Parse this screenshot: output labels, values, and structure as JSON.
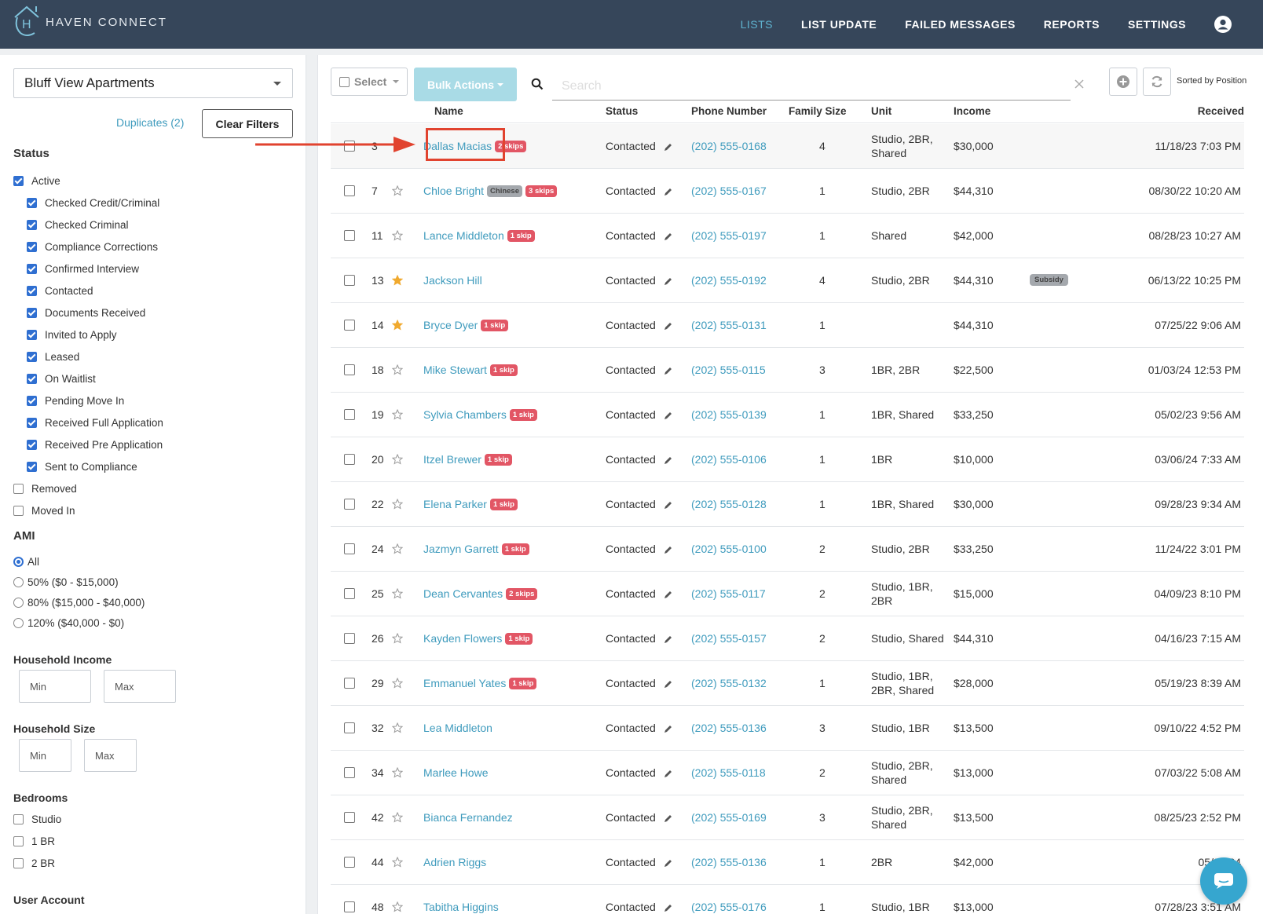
{
  "brand": {
    "name": "HAVEN CONNECT",
    "logo_letter": "H"
  },
  "nav": {
    "items": [
      {
        "label": "LISTS",
        "active": true
      },
      {
        "label": "LIST UPDATE",
        "active": false
      },
      {
        "label": "FAILED MESSAGES",
        "active": false
      },
      {
        "label": "REPORTS",
        "active": false
      },
      {
        "label": "SETTINGS",
        "active": false
      }
    ],
    "user_icon": "user-circle-icon"
  },
  "sidebar": {
    "property": "Bluff View Apartments",
    "duplicates_label": "Duplicates (2)",
    "clear_filters_label": "Clear Filters",
    "status": {
      "title": "Status",
      "active": {
        "label": "Active",
        "checked": true
      },
      "active_children": [
        {
          "label": "Checked Credit/Criminal",
          "checked": true
        },
        {
          "label": "Checked Criminal",
          "checked": true
        },
        {
          "label": "Compliance Corrections",
          "checked": true
        },
        {
          "label": "Confirmed Interview",
          "checked": true
        },
        {
          "label": "Contacted",
          "checked": true
        },
        {
          "label": "Documents Received",
          "checked": true
        },
        {
          "label": "Invited to Apply",
          "checked": true
        },
        {
          "label": "Leased",
          "checked": true
        },
        {
          "label": "On Waitlist",
          "checked": true
        },
        {
          "label": "Pending Move In",
          "checked": true
        },
        {
          "label": "Received Full Application",
          "checked": true
        },
        {
          "label": "Received Pre Application",
          "checked": true
        },
        {
          "label": "Sent to Compliance",
          "checked": true
        }
      ],
      "others": [
        {
          "label": "Removed",
          "checked": false
        },
        {
          "label": "Moved In",
          "checked": false
        }
      ]
    },
    "ami": {
      "title": "AMI",
      "options": [
        {
          "label": "All",
          "selected": true
        },
        {
          "label": "50% ($0 - $15,000)",
          "selected": false
        },
        {
          "label": "80% ($15,000 - $40,000)",
          "selected": false
        },
        {
          "label": "120% ($40,000 - $0)",
          "selected": false
        }
      ]
    },
    "household_income": {
      "title": "Household Income",
      "min_placeholder": "Min",
      "max_placeholder": "Max"
    },
    "household_size": {
      "title": "Household Size",
      "min_placeholder": "Min",
      "max_placeholder": "Max"
    },
    "bedrooms": {
      "title": "Bedrooms",
      "options": [
        {
          "label": "Studio",
          "checked": false
        },
        {
          "label": "1 BR",
          "checked": false
        },
        {
          "label": "2 BR",
          "checked": false
        }
      ]
    },
    "user_account_title": "User Account"
  },
  "toolbar": {
    "select_label": "Select",
    "bulk_actions_label": "Bulk Actions",
    "search_placeholder": "Search",
    "sorted_label": "Sorted by Position"
  },
  "table": {
    "headers": {
      "name": "Name",
      "status": "Status",
      "phone": "Phone Number",
      "family_size": "Family Size",
      "unit": "Unit",
      "income": "Income",
      "received": "Received"
    },
    "rows": [
      {
        "pos": "3",
        "starred": false,
        "name": "Dallas Macias",
        "badges": [
          "2 skips"
        ],
        "status": "Contacted",
        "phone": "(202) 555-0168",
        "family": "4",
        "unit": [
          "Studio, 2BR,",
          "Shared"
        ],
        "income": "$30,000",
        "tag": "",
        "received": "11/18/23 7:03 PM"
      },
      {
        "pos": "7",
        "starred": false,
        "name": "Chloe Bright",
        "language": "Chinese",
        "badges": [
          "3 skips"
        ],
        "status": "Contacted",
        "phone": "(202) 555-0167",
        "family": "1",
        "unit": [
          "Studio, 2BR"
        ],
        "income": "$44,310",
        "tag": "",
        "received": "08/30/22 10:20 AM"
      },
      {
        "pos": "11",
        "starred": false,
        "name": "Lance Middleton",
        "badges": [
          "1 skip"
        ],
        "status": "Contacted",
        "phone": "(202) 555-0197",
        "family": "1",
        "unit": [
          "Shared"
        ],
        "income": "$42,000",
        "tag": "",
        "received": "08/28/23 10:27 AM"
      },
      {
        "pos": "13",
        "starred": true,
        "name": "Jackson Hill",
        "badges": [],
        "status": "Contacted",
        "phone": "(202) 555-0192",
        "family": "4",
        "unit": [
          "Studio, 2BR"
        ],
        "income": "$44,310",
        "tag": "Subsidy",
        "received": "06/13/22 10:25 PM"
      },
      {
        "pos": "14",
        "starred": true,
        "name": "Bryce Dyer",
        "badges": [
          "1 skip"
        ],
        "status": "Contacted",
        "phone": "(202) 555-0131",
        "family": "1",
        "unit": [],
        "income": "$44,310",
        "tag": "",
        "received": "07/25/22 9:06 AM"
      },
      {
        "pos": "18",
        "starred": false,
        "name": "Mike Stewart",
        "badges": [
          "1 skip"
        ],
        "status": "Contacted",
        "phone": "(202) 555-0115",
        "family": "3",
        "unit": [
          "1BR, 2BR"
        ],
        "income": "$22,500",
        "tag": "",
        "received": "01/03/24 12:53 PM"
      },
      {
        "pos": "19",
        "starred": false,
        "name": "Sylvia Chambers",
        "badges": [
          "1 skip"
        ],
        "status": "Contacted",
        "phone": "(202) 555-0139",
        "family": "1",
        "unit": [
          "1BR, Shared"
        ],
        "income": "$33,250",
        "tag": "",
        "received": "05/02/23 9:56 AM"
      },
      {
        "pos": "20",
        "starred": false,
        "name": "Itzel Brewer",
        "badges": [
          "1 skip"
        ],
        "status": "Contacted",
        "phone": "(202) 555-0106",
        "family": "1",
        "unit": [
          "1BR"
        ],
        "income": "$10,000",
        "tag": "",
        "received": "03/06/24 7:33 AM"
      },
      {
        "pos": "22",
        "starred": false,
        "name": "Elena Parker",
        "badges": [
          "1 skip"
        ],
        "status": "Contacted",
        "phone": "(202) 555-0128",
        "family": "1",
        "unit": [
          "1BR, Shared"
        ],
        "income": "$30,000",
        "tag": "",
        "received": "09/28/23 9:34 AM"
      },
      {
        "pos": "24",
        "starred": false,
        "name": "Jazmyn Garrett",
        "badges": [
          "1 skip"
        ],
        "status": "Contacted",
        "phone": "(202) 555-0100",
        "family": "2",
        "unit": [
          "Studio, 2BR"
        ],
        "income": "$33,250",
        "tag": "",
        "received": "11/24/22 3:01 PM"
      },
      {
        "pos": "25",
        "starred": false,
        "name": "Dean Cervantes",
        "badges": [
          "2 skips"
        ],
        "status": "Contacted",
        "phone": "(202) 555-0117",
        "family": "2",
        "unit": [
          "Studio, 1BR,",
          "2BR"
        ],
        "income": "$15,000",
        "tag": "",
        "received": "04/09/23 8:10 PM"
      },
      {
        "pos": "26",
        "starred": false,
        "name": "Kayden Flowers",
        "badges": [
          "1 skip"
        ],
        "status": "Contacted",
        "phone": "(202) 555-0157",
        "family": "2",
        "unit": [
          "Studio, Shared"
        ],
        "income": "$44,310",
        "tag": "",
        "received": "04/16/23 7:15 AM"
      },
      {
        "pos": "29",
        "starred": false,
        "name": "Emmanuel Yates",
        "badges": [
          "1 skip"
        ],
        "status": "Contacted",
        "phone": "(202) 555-0132",
        "family": "1",
        "unit": [
          "Studio, 1BR,",
          "2BR, Shared"
        ],
        "income": "$28,000",
        "tag": "",
        "received": "05/19/23 8:39 AM"
      },
      {
        "pos": "32",
        "starred": false,
        "name": "Lea Middleton",
        "badges": [],
        "status": "Contacted",
        "phone": "(202) 555-0136",
        "family": "3",
        "unit": [
          "Studio, 1BR"
        ],
        "income": "$13,500",
        "tag": "",
        "received": "09/10/22 4:52 PM"
      },
      {
        "pos": "34",
        "starred": false,
        "name": "Marlee Howe",
        "badges": [],
        "status": "Contacted",
        "phone": "(202) 555-0118",
        "family": "2",
        "unit": [
          "Studio, 2BR,",
          "Shared"
        ],
        "income": "$13,000",
        "tag": "",
        "received": "07/03/22 5:08 AM"
      },
      {
        "pos": "42",
        "starred": false,
        "name": "Bianca Fernandez",
        "badges": [],
        "status": "Contacted",
        "phone": "(202) 555-0169",
        "family": "3",
        "unit": [
          "Studio, 2BR,",
          "Shared"
        ],
        "income": "$13,500",
        "tag": "",
        "received": "08/25/23 2:52 PM"
      },
      {
        "pos": "44",
        "starred": false,
        "name": "Adrien Riggs",
        "badges": [],
        "status": "Contacted",
        "phone": "(202) 555-0136",
        "family": "1",
        "unit": [
          "2BR"
        ],
        "income": "$42,000",
        "tag": "",
        "received": "05/31/24"
      },
      {
        "pos": "48",
        "starred": false,
        "name": "Tabitha Higgins",
        "badges": [],
        "status": "Contacted",
        "phone": "(202) 555-0176",
        "family": "1",
        "unit": [
          "Studio, 1BR"
        ],
        "income": "$13,000",
        "tag": "",
        "received": "07/28/23 3:51 AM"
      }
    ]
  },
  "colors": {
    "nav_bg": "#36465a",
    "link": "#3f9bbd",
    "badge": "#e25665",
    "star": "#f0a92e",
    "annotation": "#e1432f"
  }
}
